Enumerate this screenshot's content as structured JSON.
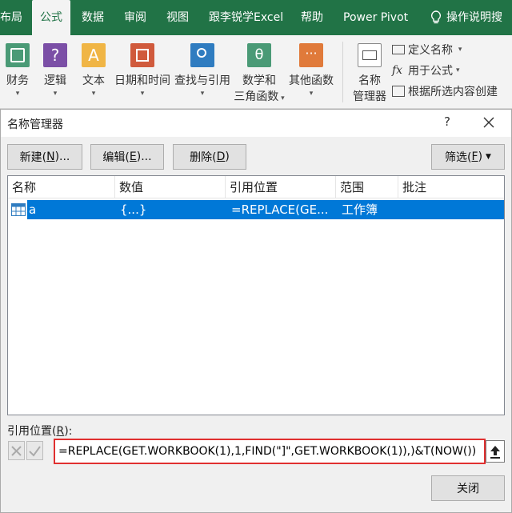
{
  "ribbon_tabs": [
    {
      "label": "布局"
    },
    {
      "label": "公式",
      "active": true
    },
    {
      "label": "数据"
    },
    {
      "label": "审阅"
    },
    {
      "label": "视图"
    },
    {
      "label": "跟李锐学Excel"
    },
    {
      "label": "帮助"
    },
    {
      "label": "Power Pivot"
    },
    {
      "label": "操作说明搜"
    }
  ],
  "ribbon_buttons": [
    {
      "label": "财务",
      "icon": "finance-icon",
      "color": "#4a9a76"
    },
    {
      "label": "逻辑",
      "icon": "logic-icon",
      "color": "#7b4fa6"
    },
    {
      "label": "文本",
      "icon": "text-icon",
      "color": "#f0b545"
    },
    {
      "label": "日期和时间",
      "icon": "date-time-icon",
      "color": "#d05a3c"
    },
    {
      "label": "查找与引用",
      "icon": "lookup-reference-icon",
      "color": "#2f7cc0"
    },
    {
      "label": "数学和",
      "label2": "三角函数",
      "icon": "math-trig-icon",
      "color": "#4a9a76"
    },
    {
      "label": "其他函数",
      "icon": "more-functions-icon",
      "color": "#e07a3a"
    }
  ],
  "name_manager_button": {
    "label": "名称",
    "label2": "管理器"
  },
  "defined_names": {
    "define_name": "定义名称",
    "use_in_formula": "用于公式",
    "create_from_selection": "根据所选内容创建"
  },
  "dialog": {
    "title": "名称管理器",
    "help": "?",
    "new_button": {
      "text": "新建(",
      "key": "N",
      "tail": ")..."
    },
    "edit_button": {
      "text": "编辑(",
      "key": "E",
      "tail": ")..."
    },
    "delete_button": {
      "text": "删除(",
      "key": "D",
      "tail": ")"
    },
    "filter_button": {
      "text": "筛选(",
      "key": "F",
      "tail": ")"
    },
    "columns": [
      "名称",
      "数值",
      "引用位置",
      "范围",
      "批注"
    ],
    "rows": [
      {
        "name": "a",
        "value": "{...}",
        "refers_to": "=REPLACE(GE...",
        "scope": "工作簿",
        "comment": ""
      }
    ],
    "refers_to_label": {
      "text": "引用位置(",
      "key": "R",
      "tail": "):"
    },
    "refers_to_value": "=REPLACE(GET.WORKBOOK(1),1,FIND(\"]\",GET.WORKBOOK(1)),)&T(NOW())",
    "close_button": "关闭"
  },
  "colors": {
    "excel_green": "#217346",
    "selection_blue": "#0078d7",
    "highlight_red": "#e03030"
  }
}
